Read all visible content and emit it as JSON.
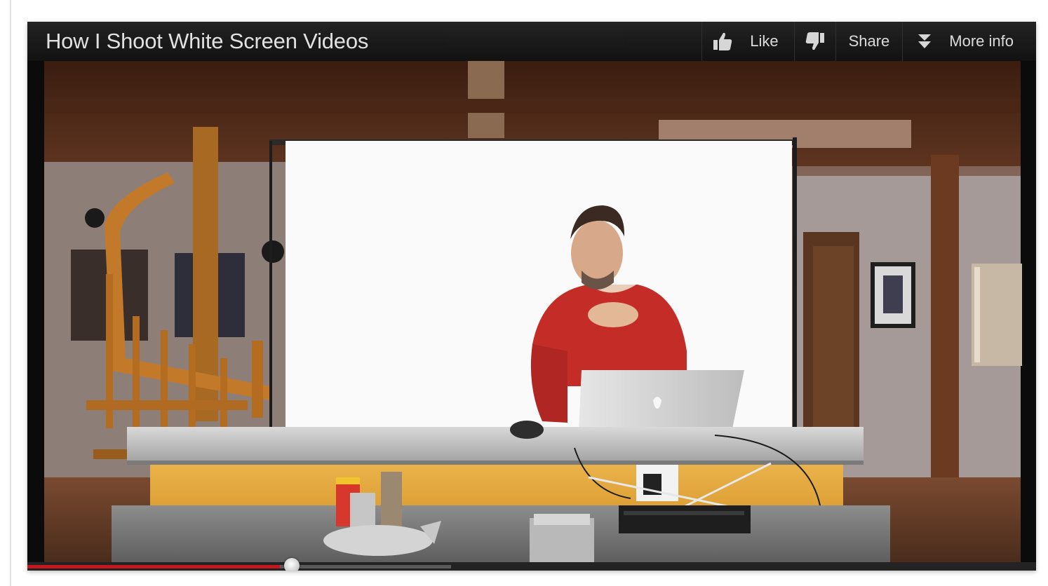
{
  "video": {
    "title": "How I Shoot White Screen Videos",
    "progress_played_fraction": 0.25,
    "progress_loaded_fraction": 0.42
  },
  "actions": {
    "like_label": "Like",
    "share_label": "Share",
    "more_info_label": "More info"
  },
  "icons": {
    "like": "thumbs-up-icon",
    "dislike": "thumbs-down-icon",
    "more_info": "double-chevron-down-icon"
  },
  "colors": {
    "progress_played": "#c4161c",
    "topbar": "#1b1b1b"
  }
}
